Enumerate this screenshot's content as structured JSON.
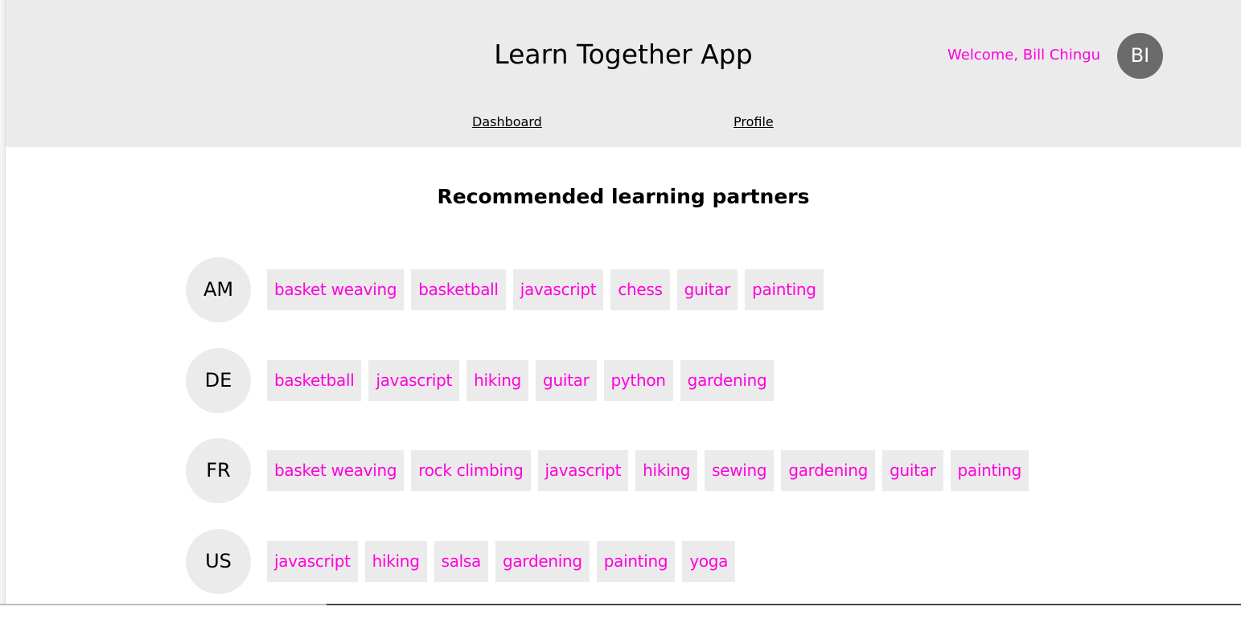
{
  "header": {
    "title": "Learn Together App",
    "welcome": "Welcome, Bill Chingu",
    "user_initials": "BI",
    "nav": [
      {
        "label": "Dashboard"
      },
      {
        "label": "Profile"
      }
    ]
  },
  "colors": {
    "accent": "#ff00dd",
    "header_bg": "#ebebeb",
    "avatar_bg": "#6b6b6b"
  },
  "main": {
    "title": "Recommended learning partners",
    "partners": [
      {
        "initials": "AM",
        "interests": [
          "basket weaving",
          "basketball",
          "javascript",
          "chess",
          "guitar",
          "painting"
        ]
      },
      {
        "initials": "DE",
        "interests": [
          "basketball",
          "javascript",
          "hiking",
          "guitar",
          "python",
          "gardening"
        ]
      },
      {
        "initials": "FR",
        "interests": [
          "basket weaving",
          "rock climbing",
          "javascript",
          "hiking",
          "sewing",
          "gardening",
          "guitar",
          "painting"
        ]
      },
      {
        "initials": "US",
        "interests": [
          "javascript",
          "hiking",
          "salsa",
          "gardening",
          "painting",
          "yoga"
        ]
      }
    ]
  }
}
